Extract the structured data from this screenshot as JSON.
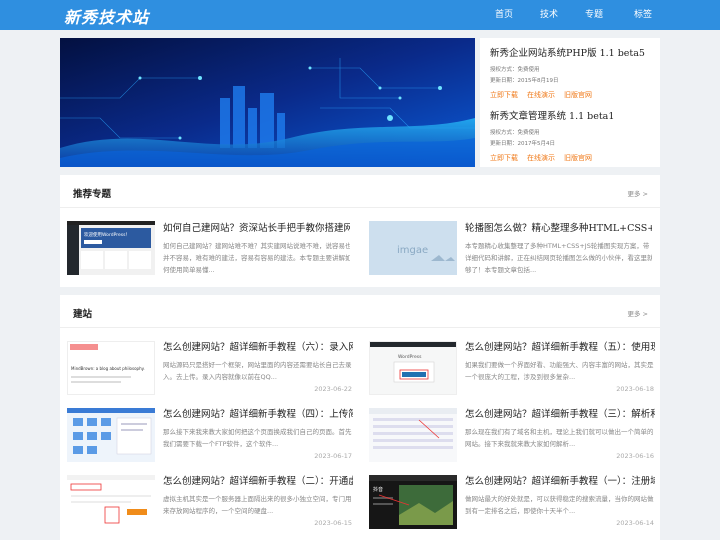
{
  "site": {
    "logo": "新秀技术站"
  },
  "nav": [
    "首页",
    "技术",
    "专题",
    "标签"
  ],
  "software": [
    {
      "title": "新秀企业网站系统PHP版 1.1 beta5",
      "license": "授权方式：免费使用",
      "date": "更新日期：2015年8月19日",
      "links": [
        "立即下载",
        "在线演示",
        "旧版官网"
      ]
    },
    {
      "title": "新秀文章管理系统 1.1 beta1",
      "license": "授权方式：免费使用",
      "date": "更新日期：2017年5月4日",
      "links": [
        "立即下载",
        "在线演示",
        "旧版官网"
      ]
    }
  ],
  "topics": {
    "title": "推荐专题",
    "more": "更多 >",
    "items": [
      {
        "title": "如何自己建网站？资深站长手把手教你搭建网站",
        "desc": "如何自己建网站？建网站难不难？其实建网站说难不难，说容易也并不容易，难有难的建法，容易有容易的建法。本专题主要讲解如何使用简单易懂..."
      },
      {
        "title": "轮播图怎么做？精心整理多种HTML+CSS+JS轮播图",
        "desc": "本专题精心收集整理了多种HTML+CSS+JS轮播图实现方案，带详细代码和讲解，正在纠结网页轮播图怎么做的小伙伴，看这里就够了！本专题文章包括...",
        "thumb_text": "imgae"
      }
    ]
  },
  "jianzhan": {
    "title": "建站",
    "more": "更多 >",
    "posts": [
      {
        "title": "怎么创建网站？超详细新手教程（六）：录入网站",
        "desc": "网站源码只是搭好一个框架，网站里面的内容还需要站长自己去录入。去上传。录入内容就像以前在QQ...",
        "date": "2023-06-22",
        "thumb_text": "MindBrown: a blog about philosophy."
      },
      {
        "title": "怎么创建网站？超详细新手教程（五）：使用现成",
        "desc": "如果我们要做一个界面好看、功能强大、内容丰富的网站，其实是一个很庞大的工程，涉及到很多复杂...",
        "date": "2023-06-18",
        "thumb_text": "WordPress"
      },
      {
        "title": "怎么创建网站？超详细新手教程（四）：上传简单",
        "desc": "那么接下来我来教大家如何把这个页面换成我们自己的页面。首先我们需要下载一个FTP软件，这个软件...",
        "date": "2023-06-17"
      },
      {
        "title": "怎么创建网站？超详细新手教程（三）：解析和绑",
        "desc": "那么现在我们有了域名和主机，理论上我们就可以做出一个简单的网站。接下来我就来教大家如何解析...",
        "date": "2023-06-16"
      },
      {
        "title": "怎么创建网站？超详细新手教程（二）：开通虚拟",
        "desc": "虚拟主机其实是一个服务器上面隔出来的很多小独立空间，专门用来存放网站程序的，一个空间的硬盘...",
        "date": "2023-06-15"
      },
      {
        "title": "怎么创建网站？超详细新手教程（一）：注册域名",
        "desc": "做网站最大的好处就是，可以获得稳定的搜索流量，当你的网站做到有一定排名之后，即使你十天半个...",
        "date": "2023-06-14",
        "thumb_text": "抖音"
      }
    ]
  },
  "topic1_thumb": {
    "headline": "欢迎使用WordPress！",
    "button": "自定义您的站点"
  }
}
